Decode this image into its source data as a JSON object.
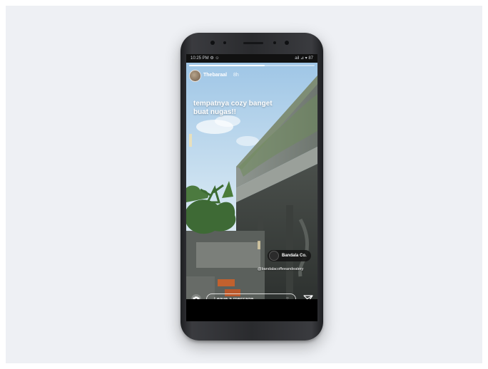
{
  "status_bar": {
    "time": "10:25 PM ⚙ ☺",
    "icons": "ail ⊿ ▾ 87"
  },
  "story": {
    "username": "Thebaraal",
    "time_ago": "8h",
    "progress_fraction": 0.6,
    "caption": "tempatnya cozy banget buat nugas!!",
    "mention_name": "Bandala Co.",
    "mention_handle": "@bandalacoffeeandeatery"
  },
  "message_bar": {
    "placeholder": "Leave a message",
    "camera_icon": "camera-icon",
    "send_icon": "send-icon",
    "emoji_icon": "emoji-icon"
  },
  "colors": {
    "backdrop": "#eef0f4",
    "phone_body": "#2a2b2e",
    "sky": "#bcd8ec"
  }
}
